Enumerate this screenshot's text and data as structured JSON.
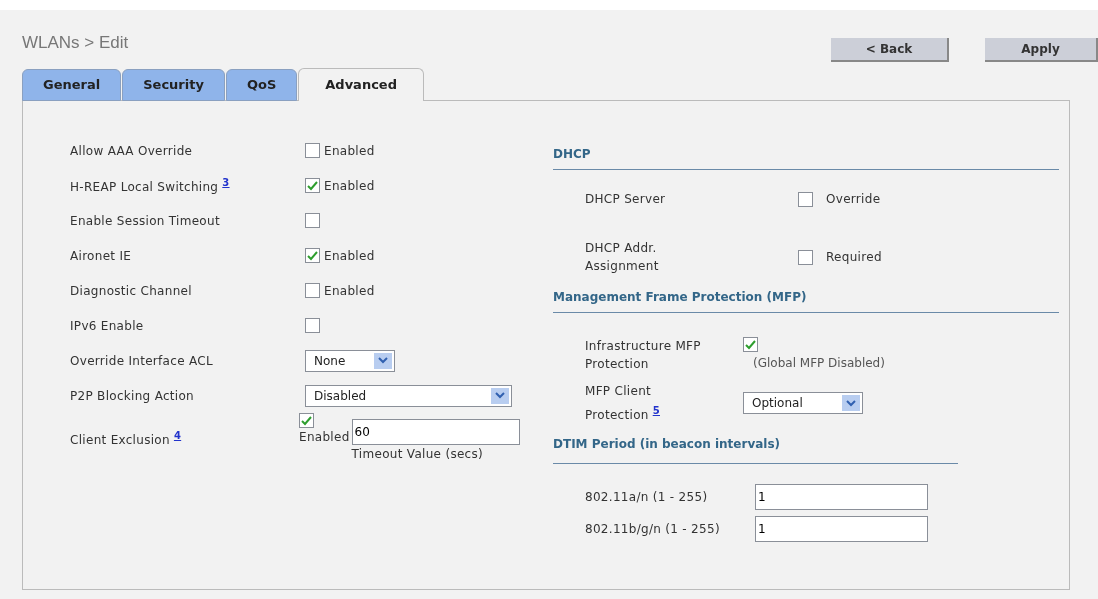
{
  "header": {
    "title": "WLANs > Edit",
    "buttons": [
      "< Back",
      "Apply"
    ]
  },
  "tabs": [
    {
      "label": "General",
      "selected": false
    },
    {
      "label": "Security",
      "selected": false
    },
    {
      "label": "QoS",
      "selected": false
    },
    {
      "label": "Advanced",
      "selected": true
    }
  ],
  "left_settings": [
    {
      "kind": "checkbox",
      "label": "Allow AAA Override",
      "checked": false,
      "option": "Enabled"
    },
    {
      "kind": "checkbox",
      "label": "H-REAP Local Switching",
      "footnote": "3",
      "checked": true,
      "option": "Enabled"
    },
    {
      "kind": "checkbox",
      "label": "Enable Session Timeout",
      "checked": false
    },
    {
      "kind": "checkbox",
      "label": "Aironet IE",
      "checked": true,
      "option": "Enabled"
    },
    {
      "kind": "checkbox",
      "label": "Diagnostic Channel",
      "checked": false,
      "option": "Enabled"
    },
    {
      "kind": "checkbox",
      "label": "IPv6 Enable",
      "checked": false
    },
    {
      "kind": "select",
      "label": "Override Interface ACL",
      "value": "None"
    },
    {
      "kind": "select_wide",
      "label": "P2P Blocking Action",
      "value": "Disabled"
    },
    {
      "kind": "exclusion",
      "label": "Client Exclusion",
      "footnote": "4",
      "checked": true,
      "option": "Enabled",
      "value": "60",
      "caption": "Timeout Value (secs)"
    }
  ],
  "dhcp": {
    "heading": "DHCP",
    "rows": [
      {
        "label": "DHCP Server",
        "checked": false,
        "option": "Override"
      },
      {
        "label": "DHCP Addr. Assignment",
        "checked": false,
        "option": "Required"
      }
    ]
  },
  "mfp": {
    "heading": "Management Frame Protection (MFP)",
    "infrastructure": {
      "label": "Infrastructure MFP Protection",
      "checked": true,
      "note": "(Global MFP Disabled)"
    },
    "client": {
      "label": "MFP Client Protection",
      "footnote": "5",
      "value": "Optional"
    }
  },
  "dtim": {
    "heading": "DTIM Period (in beacon intervals)",
    "rows": [
      {
        "label": "802.11a/n (1 - 255)",
        "value": "1"
      },
      {
        "label": "802.11b/g/n (1 - 255)",
        "value": "1"
      }
    ]
  }
}
